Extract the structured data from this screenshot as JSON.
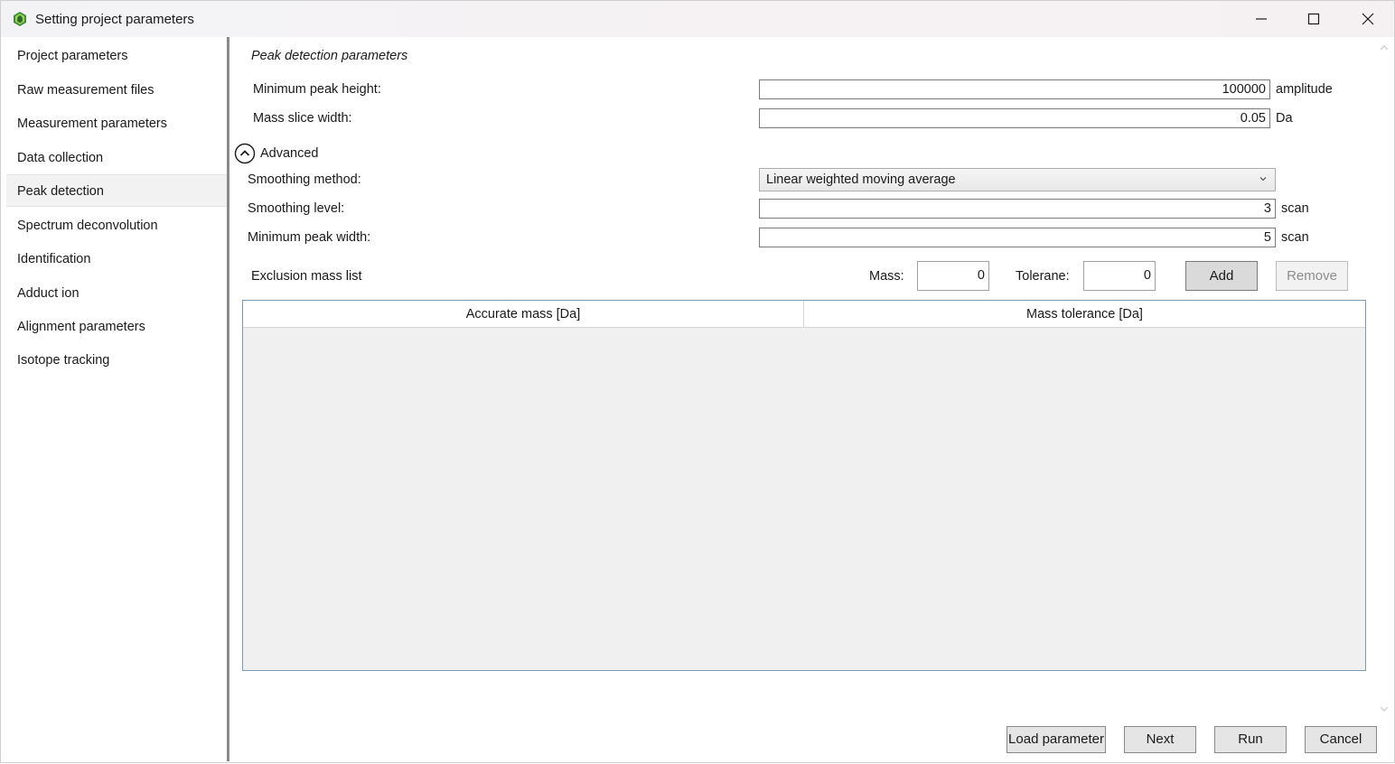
{
  "window": {
    "title": "Setting project parameters",
    "minimize_icon": "minimize-icon",
    "maximize_icon": "maximize-icon",
    "close_icon": "close-icon"
  },
  "sidebar": {
    "items": [
      {
        "label": "Project parameters",
        "active": false
      },
      {
        "label": "Raw measurement files",
        "active": false
      },
      {
        "label": "Measurement parameters",
        "active": false
      },
      {
        "label": "Data collection",
        "active": false
      },
      {
        "label": "Peak detection",
        "active": true
      },
      {
        "label": "Spectrum deconvolution",
        "active": false
      },
      {
        "label": "Identification",
        "active": false
      },
      {
        "label": "Adduct ion",
        "active": false
      },
      {
        "label": "Alignment parameters",
        "active": false
      },
      {
        "label": "Isotope tracking",
        "active": false
      }
    ]
  },
  "main": {
    "section_title": "Peak detection parameters",
    "min_peak_height": {
      "label": "Minimum peak height:",
      "value": "100000",
      "unit": "amplitude"
    },
    "mass_slice_width": {
      "label": "Mass slice width:",
      "value": "0.05",
      "unit": "Da"
    },
    "advanced": {
      "label": "Advanced",
      "icon": "chevron-up-circle-icon"
    },
    "smoothing_method": {
      "label": "Smoothing method:",
      "value": "Linear weighted moving average"
    },
    "smoothing_level": {
      "label": "Smoothing level:",
      "value": "3",
      "unit": "scan"
    },
    "min_peak_width": {
      "label": "Minimum peak width:",
      "value": "5",
      "unit": "scan"
    },
    "exclusion": {
      "label": "Exclusion mass list",
      "mass_label": "Mass:",
      "mass_value": "0",
      "tolerance_label": "Tolerane:",
      "tolerance_value": "0",
      "add_label": "Add",
      "remove_label": "Remove"
    },
    "table": {
      "columns": [
        "Accurate mass [Da]",
        "Mass tolerance [Da]"
      ],
      "rows": []
    }
  },
  "footer": {
    "load_label": "Load parameter",
    "next_label": "Next",
    "run_label": "Run",
    "cancel_label": "Cancel"
  }
}
